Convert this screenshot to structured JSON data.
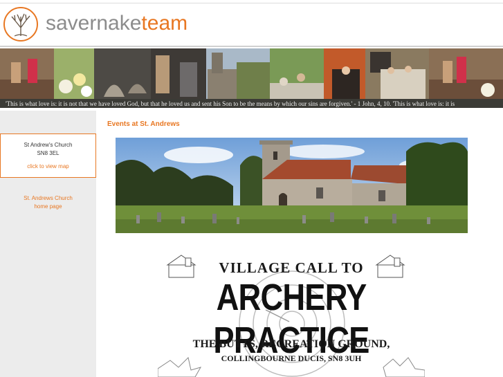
{
  "brand": {
    "name_part1": "savernake",
    "name_part2": "team",
    "logo_icon": "tree-icon"
  },
  "banner": {
    "verse": "'This is what love is: it is not that we have loved God, but that he loved us and sent his Son to be the means by which our sins are forgiven.' - 1 John, 4, 10.    'This is what love is: it is"
  },
  "sidebar": {
    "map_box": {
      "name": "St Andrew's Church",
      "postcode": "SN8 3EL",
      "link": "click to view map"
    },
    "home_link": {
      "line1": "St. Andrews Church",
      "line2": "home page"
    }
  },
  "main": {
    "title": "Events at St. Andrews",
    "poster": {
      "line1": "VILLAGE CALL TO",
      "line2": "ARCHERY PRACTICE",
      "line3": "THE BUTTS, RECREATION GROUND,",
      "line4": "COLLINGBOURNE DUCIS, SN8 3UH"
    }
  },
  "colors": {
    "accent": "#e87722",
    "sidebar_bg": "#ececec",
    "grey_text": "#8c8c8c"
  }
}
